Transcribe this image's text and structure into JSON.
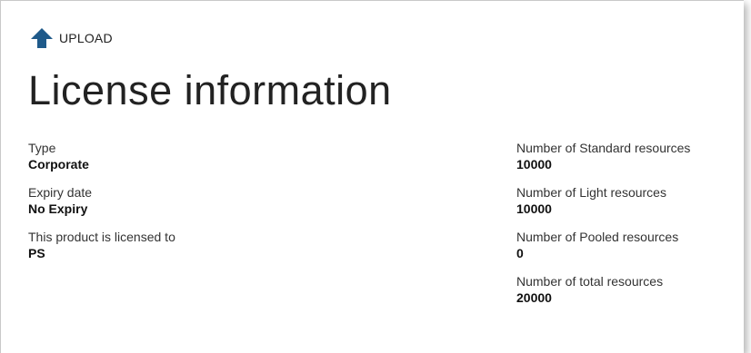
{
  "toolbar": {
    "upload_label": "UPLOAD",
    "upload_icon": "arrow-up-icon",
    "accent_color": "#1f5a8a"
  },
  "page": {
    "title": "License information"
  },
  "left_fields": [
    {
      "label": "Type",
      "value": "Corporate"
    },
    {
      "label": "Expiry date",
      "value": "No Expiry"
    },
    {
      "label": "This product is licensed to",
      "value": "PS"
    }
  ],
  "right_fields": [
    {
      "label": "Number of Standard resources",
      "value": "10000"
    },
    {
      "label": "Number of Light resources",
      "value": "10000"
    },
    {
      "label": "Number of Pooled resources",
      "value": "0"
    },
    {
      "label": "Number of total resources",
      "value": "20000"
    }
  ]
}
